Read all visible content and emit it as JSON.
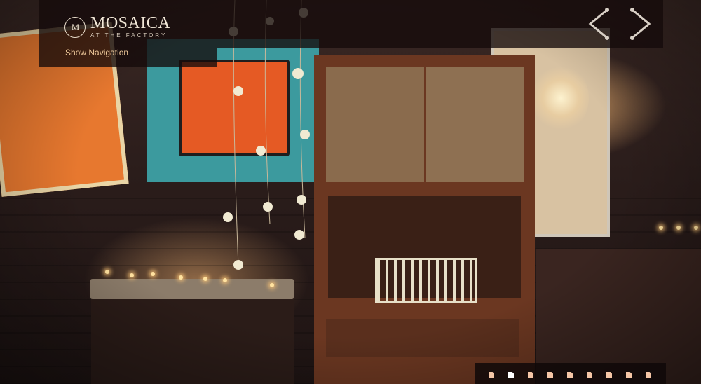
{
  "brand": {
    "monogram": "M",
    "title": "MOSAICA",
    "subtitle": "AT THE FACTORY"
  },
  "nav": {
    "show_navigation_label": "Show Navigation"
  },
  "slider": {
    "prev_icon": "chevron-left-icon",
    "next_icon": "chevron-right-icon",
    "total_slides": 9,
    "active_index": 1
  },
  "colors": {
    "accent": "#eec89a",
    "dot": "#f5c6a6",
    "dot_active": "#ffffff",
    "header_bg": "#140a0a"
  }
}
